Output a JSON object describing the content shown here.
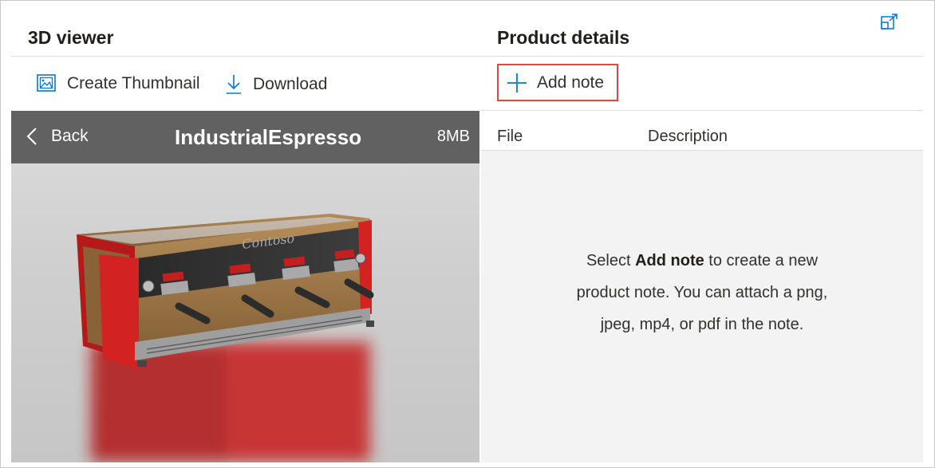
{
  "left_pane": {
    "title": "3D viewer",
    "toolbar": {
      "create_thumbnail": "Create Thumbnail",
      "download": "Download"
    },
    "viewer": {
      "back_label": "Back",
      "model_name": "IndustrialEspresso",
      "model_size": "8MB",
      "brand_text": "Contoso"
    }
  },
  "right_pane": {
    "title": "Product details",
    "add_note_label": "Add note",
    "columns": {
      "file": "File",
      "description": "Description"
    },
    "empty_message": {
      "prefix": "Select ",
      "bold": "Add note",
      "suffix": " to create a new product note. You can attach a png, jpeg, mp4, or pdf in the note."
    }
  },
  "colors": {
    "accent": "#0078d4",
    "highlight": "#e04646",
    "viewer_header": "#616161",
    "machine_red": "#d32222"
  },
  "icons": [
    "expand-icon",
    "image-icon",
    "download-icon",
    "plus-icon",
    "chevron-left-icon"
  ]
}
